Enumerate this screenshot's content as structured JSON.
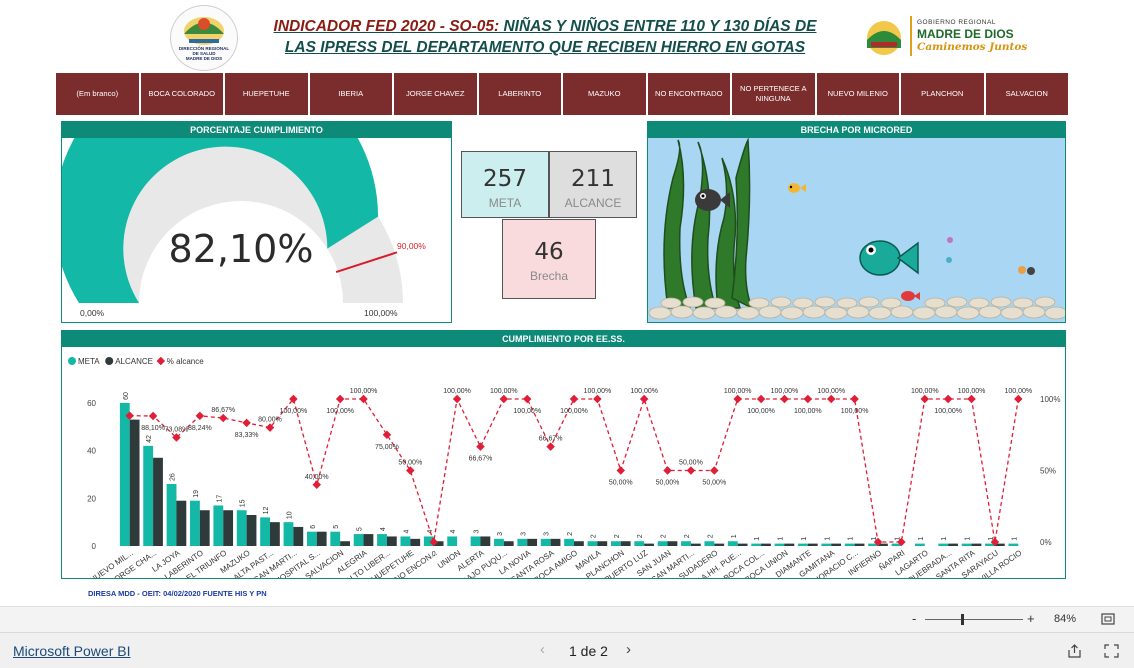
{
  "header": {
    "title_red_part": "INDICADOR FED 2020 - SO-05: ",
    "title_green_part": "NIÑAS Y NIÑOS ENTRE 110 Y 130 DÍAS DE",
    "title_line2": "LAS IPRESS DEL DEPARTAMENTO QUE RECIBEN HIERRO EN GOTAS",
    "logo_left_text": [
      "DIRECCIÓN REGIONAL",
      "DE SALUD",
      "MADRE DE DIOS"
    ],
    "logo_right_text": [
      "GOBIERNO REGIONAL",
      "MADRE DE DIOS",
      "Caminemos Juntos"
    ]
  },
  "slicer": {
    "items": [
      "(Em branco)",
      "BOCA COLORADO",
      "HUEPETUHE",
      "IBERIA",
      "JORGE CHAVEZ",
      "LABERINTO",
      "MAZUKO",
      "NO ENCONTRADO",
      "NO PERTENECE A NINGUNA",
      "NUEVO MILENIO",
      "PLANCHON",
      "SALVACION"
    ],
    "color": "#7b2c2c"
  },
  "gauge": {
    "title": "PORCENTAJE CUMPLIMIENTO",
    "value": 82.1,
    "value_label": "82,10%",
    "target": 90.0,
    "target_label": "90,00%",
    "min_label": "0,00%",
    "max_label": "100,00%",
    "fill_color": "#14b8a6",
    "target_color": "#d81e2c"
  },
  "cards": {
    "meta": {
      "value": "257",
      "label": "META",
      "bg": "#cdeeee"
    },
    "alcance": {
      "value": "211",
      "label": "ALCANCE",
      "bg": "#dedede"
    },
    "brecha": {
      "value": "46",
      "label": "Brecha",
      "bg": "#f9dadd"
    }
  },
  "brecha_panel": {
    "title": "BRECHA POR MICRORED"
  },
  "chart_data": {
    "title": "CUMPLIMIENTO POR EE.SS.",
    "type": "bar",
    "legend": [
      "META",
      "ALCANCE",
      "% alcance"
    ],
    "legend_position": "top-left",
    "colors": {
      "meta": "#14b8a6",
      "alcance": "#2f3b3b",
      "pct": "#e01e37"
    },
    "categories": [
      "NUEVO MIL...",
      "JORGE CHA...",
      "LA JOYA",
      "LABERINTO",
      "EL TRIUNFO",
      "MAZUKO",
      "ALTA PAST...",
      "SAN MARTI...",
      "HOSPITAL S...",
      "SALVACION",
      "ALEGRIA",
      "ALTO LIBER...",
      "HUEPETUHE",
      "NO ENCON...",
      "UNION",
      "ALERTA",
      "BAJO PUQU...",
      "LA NOVIA",
      "SANTA ROSA",
      "BOCA AMIGO",
      "MAVILA",
      "PLANCHON",
      "PUERTO LUZ",
      "SAN JUAN",
      "SAN MARTI...",
      "SUDADERO",
      "AA.HH. PUE...",
      "BOCA COL...",
      "BOCA UNION",
      "DIAMANTE",
      "GAMITANA",
      "HORACIO C...",
      "INFIERNO",
      "ÑAPARI",
      "LAGARTO",
      "QUEBRADA...",
      "SANTA RITA",
      "SARAYACU",
      "VILLA ROCIO"
    ],
    "series": [
      {
        "name": "META",
        "values": [
          60,
          42,
          26,
          19,
          17,
          15,
          12,
          10,
          6,
          6,
          5,
          5,
          4,
          4,
          4,
          4,
          3,
          3,
          3,
          3,
          2,
          2,
          2,
          2,
          2,
          2,
          2,
          1,
          1,
          1,
          1,
          1,
          1,
          1,
          1,
          1,
          1,
          1,
          1
        ]
      },
      {
        "name": "ALCANCE",
        "values": [
          53,
          37,
          19,
          15,
          15,
          13,
          10,
          8,
          6,
          2,
          5,
          4,
          3,
          2,
          0,
          4,
          2,
          3,
          3,
          2,
          2,
          2,
          1,
          2,
          1,
          1,
          1,
          1,
          1,
          1,
          1,
          1,
          1,
          0,
          0,
          1,
          1,
          1,
          0
        ]
      },
      {
        "name": "% alcance",
        "values": [
          88.33,
          88.1,
          73.08,
          88.24,
          86.67,
          83.33,
          80.0,
          100.0,
          40.0,
          100.0,
          100.0,
          75.0,
          50.0,
          0,
          100.0,
          66.67,
          100.0,
          100.0,
          66.67,
          100.0,
          100.0,
          50.0,
          100.0,
          50.0,
          50.0,
          50.0,
          100.0,
          100.0,
          100.0,
          100.0,
          100.0,
          100.0,
          0,
          0,
          100.0,
          100.0,
          100.0,
          0,
          100.0
        ]
      }
    ],
    "bar_labels": [
      "60",
      "42",
      "26",
      "19",
      "17",
      "15",
      "12",
      "10",
      "6",
      "5",
      "5",
      "4",
      "4",
      "4",
      "4",
      "3",
      "3",
      "3",
      "3",
      "2",
      "2",
      "2",
      "2",
      "2",
      "2",
      "2",
      "1",
      "1",
      "1",
      "1",
      "1",
      "1",
      "1",
      "1",
      "1",
      "1",
      "1",
      "1",
      "1"
    ],
    "pct_labels": [
      "",
      "88,10%",
      "73,08%",
      "88,24%",
      "86,67%",
      "83,33%",
      "80,00%",
      "100,00%",
      "40,00%",
      "100,00%",
      "100,00%",
      "75,00%",
      "50,00%",
      "0",
      "100,00%",
      "66,67%",
      "100,00%",
      "100,00%",
      "66,67%",
      "100,00%",
      "100,00%",
      "50,00%",
      "100,00%",
      "50,00%",
      "50,00%",
      "50,00%",
      "100,00%",
      "100,00%",
      "100,00%",
      "100,00%",
      "100,00%",
      "100,00%",
      "",
      "",
      "100,00%",
      "100,00%",
      "100,00%",
      "",
      "100,00%"
    ],
    "y_left_ticks": [
      "60",
      "40",
      "20",
      "0"
    ],
    "y_right_ticks": [
      "100%",
      "50%",
      "0%"
    ],
    "ylim": [
      0,
      65
    ],
    "grid": false
  },
  "footer": {
    "source": "DIRESA MDD - OEIT:  04/02/2020 FUENTE HIS Y PN",
    "zoom": "84%",
    "minus": "-",
    "plus": "+",
    "powerbi_link": "Microsoft Power BI",
    "page_indicator": "1 de 2"
  }
}
